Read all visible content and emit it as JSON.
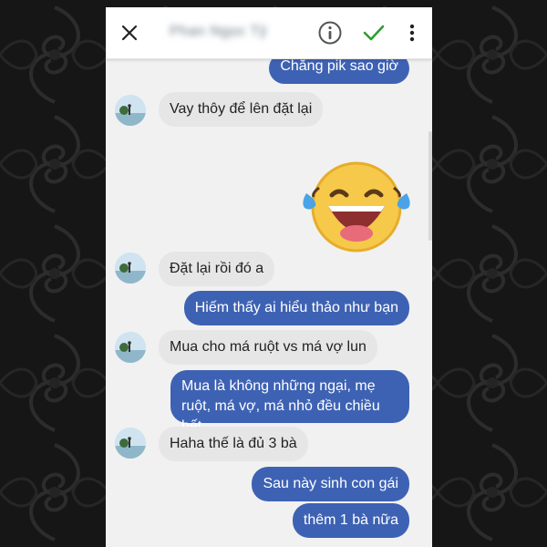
{
  "header": {
    "contact_name": "Phan Ngọc Tỷ",
    "icons": [
      "close-icon",
      "info-icon",
      "check-icon",
      "more-vert-icon"
    ],
    "accent_check": "#2e9e2e"
  },
  "messages": [
    {
      "side": "out",
      "text": "Chẳng pik sao giờ"
    },
    {
      "side": "in",
      "text": "Vay thôy để lên đặt lại"
    },
    {
      "side": "out",
      "sticker": "laughing-face-sticker"
    },
    {
      "side": "in",
      "text": "Đặt lại rồi đó a"
    },
    {
      "side": "out",
      "text": "Hiếm thấy ai hiểu thảo như bạn"
    },
    {
      "side": "in",
      "text": "Mua cho má ruột vs má vợ lun"
    },
    {
      "side": "out",
      "text": "Mua là không những ngại, mẹ ruột, má vợ, má nhỏ đều chiều hết"
    },
    {
      "side": "in",
      "text": "Haha thế là đủ 3 bà"
    },
    {
      "side": "out",
      "text": "Sau này sinh con gái"
    },
    {
      "side": "out",
      "text": "thêm 1 bà nữa"
    }
  ],
  "colors": {
    "outgoing_bubble": "#3e62b3",
    "incoming_bubble": "#e6e6e6",
    "chat_background": "#f1f1f1"
  }
}
